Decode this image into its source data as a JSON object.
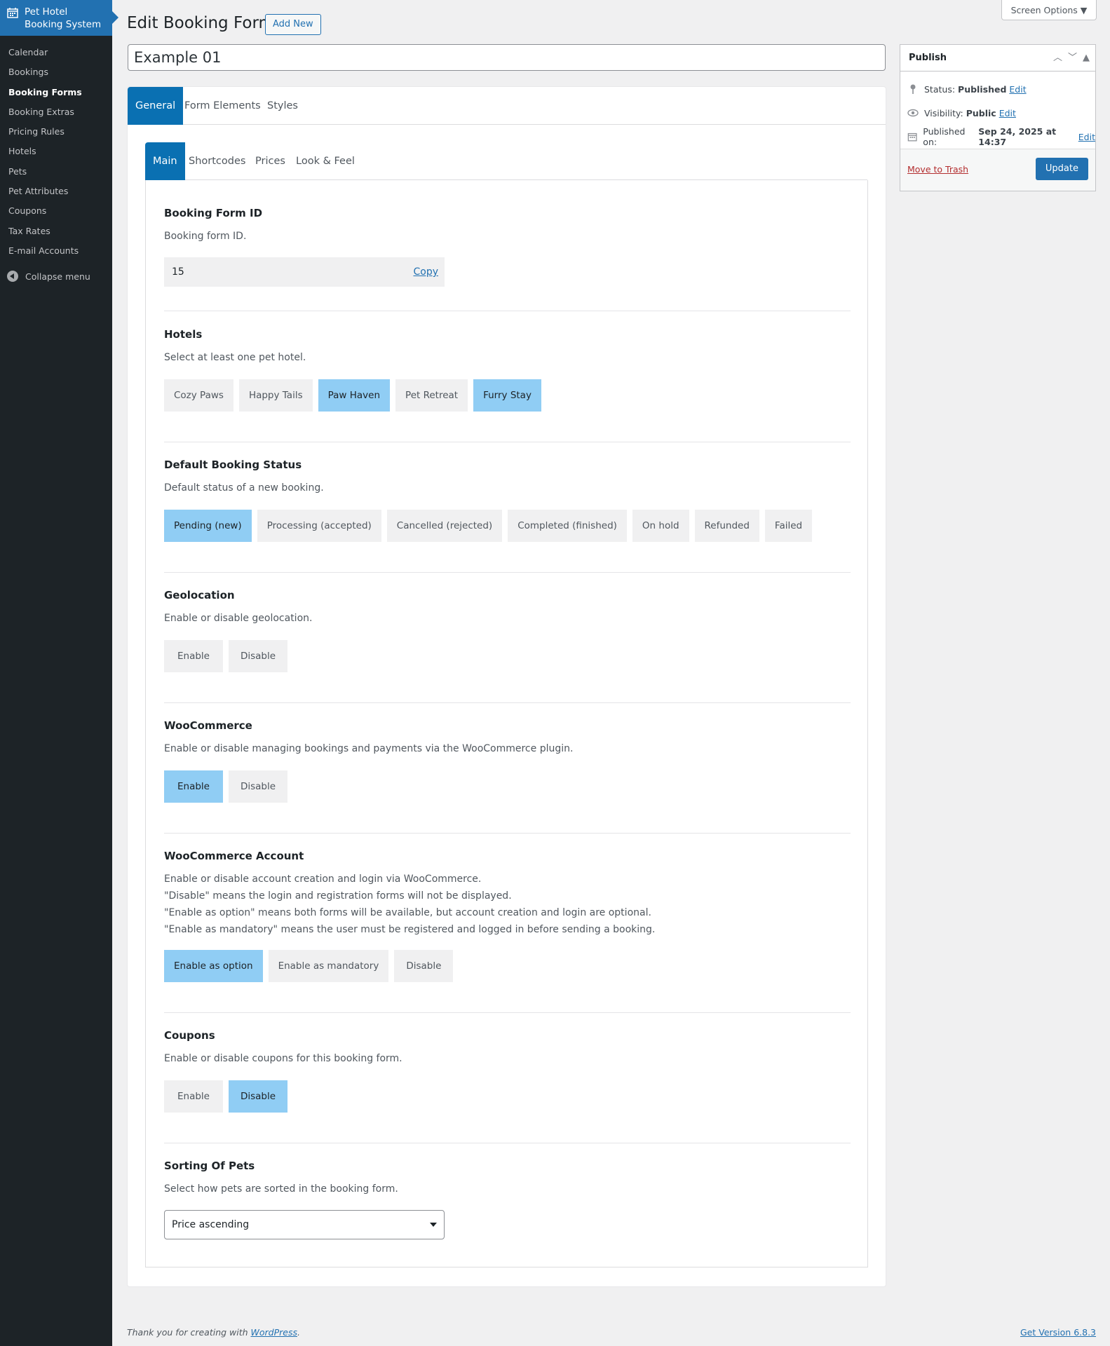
{
  "sidebar": {
    "brand_line1": "Pet Hotel",
    "brand_line2": "Booking System",
    "items": [
      "Calendar",
      "Bookings",
      "Booking Forms",
      "Booking Extras",
      "Pricing Rules",
      "Hotels",
      "Pets",
      "Pet Attributes",
      "Coupons",
      "Tax Rates",
      "E-mail Accounts"
    ],
    "current": "Booking Forms",
    "collapse_label": "Collapse menu"
  },
  "header": {
    "title": "Edit Booking Form",
    "add_new": "Add New",
    "screen_options": "Screen Options ▼"
  },
  "form_title": "Example 01",
  "tabs": [
    "General",
    "Form Elements",
    "Styles"
  ],
  "subtabs": [
    "Main",
    "Shortcodes",
    "Prices",
    "Look & Feel"
  ],
  "sections": {
    "booking_form_id": {
      "title": "Booking Form ID",
      "desc": "Booking form ID.",
      "value": "15",
      "copy": "Copy"
    },
    "hotels": {
      "title": "Hotels",
      "desc": "Select at least one pet hotel.",
      "options": [
        "Cozy Paws",
        "Happy Tails",
        "Paw Haven",
        "Pet Retreat",
        "Furry Stay"
      ],
      "selected": [
        "Paw Haven",
        "Furry Stay"
      ]
    },
    "default_status": {
      "title": "Default Booking Status",
      "desc": "Default status of a new booking.",
      "options": [
        "Pending (new)",
        "Processing (accepted)",
        "Cancelled (rejected)",
        "Completed (finished)",
        "On hold",
        "Refunded",
        "Failed"
      ],
      "selected": [
        "Pending (new)"
      ]
    },
    "geolocation": {
      "title": "Geolocation",
      "desc": "Enable or disable geolocation.",
      "options": [
        "Enable",
        "Disable"
      ],
      "selected": []
    },
    "woocommerce": {
      "title": "WooCommerce",
      "desc": "Enable or disable managing bookings and payments via the WooCommerce plugin.",
      "options": [
        "Enable",
        "Disable"
      ],
      "selected": [
        "Enable"
      ]
    },
    "woo_account": {
      "title": "WooCommerce Account",
      "desc1": "Enable or disable account creation and login via WooCommerce.",
      "desc2": "\"Disable\" means the login and registration forms will not be displayed.",
      "desc3": "\"Enable as option\" means both forms will be available, but account creation and login are optional.",
      "desc4": "\"Enable as mandatory\" means the user must be registered and logged in before sending a booking.",
      "options": [
        "Enable as option",
        "Enable as mandatory",
        "Disable"
      ],
      "selected": [
        "Enable as option"
      ]
    },
    "coupons": {
      "title": "Coupons",
      "desc": "Enable or disable coupons for this booking form.",
      "options": [
        "Enable",
        "Disable"
      ],
      "selected": [
        "Disable"
      ]
    },
    "sorting": {
      "title": "Sorting Of Pets",
      "desc": "Select how pets are sorted in the booking form.",
      "value": "Price ascending"
    }
  },
  "publish": {
    "title": "Publish",
    "status_label": "Status:",
    "status_value": "Published",
    "visibility_label": "Visibility:",
    "visibility_value": "Public",
    "published_label": "Published on:",
    "published_value": "Sep 24, 2025 at 14:37",
    "edit": "Edit",
    "trash": "Move to Trash",
    "update": "Update"
  },
  "footer": {
    "thanks": "Thank you for creating with ",
    "wp": "WordPress",
    "dot": ".",
    "version": "Get Version 6.8.3"
  },
  "colors": {
    "accent": "#2271b1",
    "selected_option": "#90cdf4",
    "sidebar": "#1d2327",
    "active_tab": "#0a70b2"
  }
}
